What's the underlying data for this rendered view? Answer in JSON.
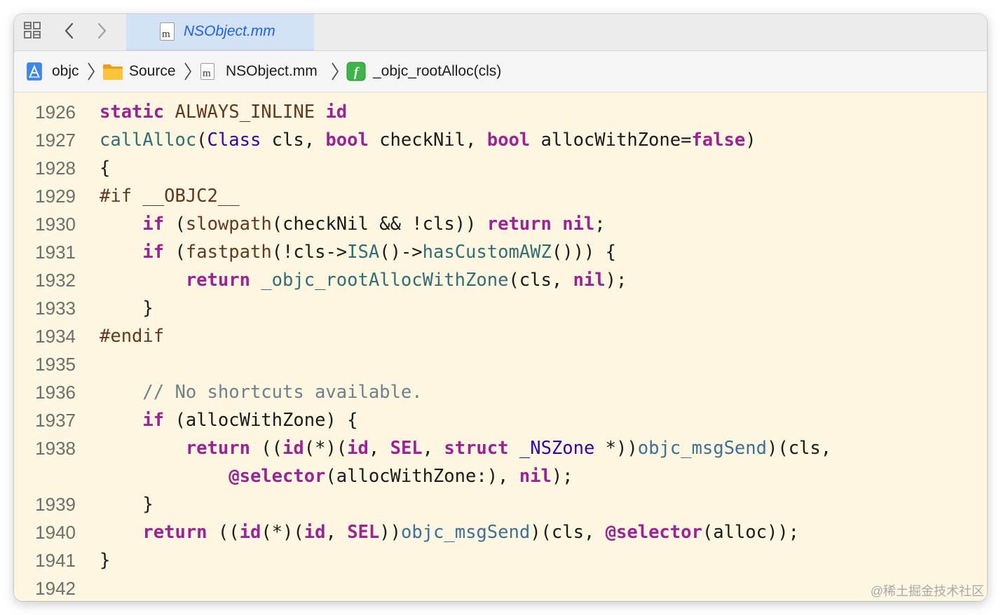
{
  "tab": {
    "label": "NSObject.mm"
  },
  "breadcrumb": {
    "items": [
      {
        "label": "objc",
        "icon": "project-icon"
      },
      {
        "label": "Source",
        "icon": "folder-icon"
      },
      {
        "label": "NSObject.mm",
        "icon": "objc-file-icon"
      },
      {
        "label": "_objc_rootAlloc(cls)",
        "icon": "function-icon"
      }
    ]
  },
  "editor": {
    "line_numbers": [
      "1926",
      "1927",
      "1928",
      "1929",
      "1930",
      "1931",
      "1932",
      "1933",
      "1934",
      "1935",
      "1936",
      "1937",
      "1938",
      "1939",
      "1940",
      "1941",
      "1942"
    ],
    "lines": [
      [
        [
          "kw",
          "static"
        ],
        [
          "p",
          " "
        ],
        [
          "mc",
          "ALWAYS_INLINE"
        ],
        [
          "p",
          " "
        ],
        [
          "kw",
          "id"
        ]
      ],
      [
        [
          "fn",
          "callAlloc"
        ],
        [
          "p",
          "("
        ],
        [
          "ty",
          "Class"
        ],
        [
          "p",
          " cls, "
        ],
        [
          "kw",
          "bool"
        ],
        [
          "p",
          " checkNil, "
        ],
        [
          "kw",
          "bool"
        ],
        [
          "p",
          " allocWithZone="
        ],
        [
          "kw",
          "false"
        ],
        [
          "p",
          ")"
        ]
      ],
      [
        [
          "p",
          "{"
        ]
      ],
      [
        [
          "pp",
          "#if __OBJC2__"
        ]
      ],
      [
        [
          "p",
          "    "
        ],
        [
          "kw",
          "if"
        ],
        [
          "p",
          " ("
        ],
        [
          "mc",
          "slowpath"
        ],
        [
          "p",
          "(checkNil && !cls)) "
        ],
        [
          "kw",
          "return"
        ],
        [
          "p",
          " "
        ],
        [
          "kw",
          "nil"
        ],
        [
          "p",
          ";"
        ]
      ],
      [
        [
          "p",
          "    "
        ],
        [
          "kw",
          "if"
        ],
        [
          "p",
          " ("
        ],
        [
          "mc",
          "fastpath"
        ],
        [
          "p",
          "(!cls->"
        ],
        [
          "fn",
          "ISA"
        ],
        [
          "p",
          "()->"
        ],
        [
          "fn",
          "hasCustomAWZ"
        ],
        [
          "p",
          "())) {"
        ]
      ],
      [
        [
          "p",
          "        "
        ],
        [
          "kw",
          "return"
        ],
        [
          "p",
          " "
        ],
        [
          "fn",
          "_objc_rootAllocWithZone"
        ],
        [
          "p",
          "(cls, "
        ],
        [
          "kw",
          "nil"
        ],
        [
          "p",
          ");"
        ]
      ],
      [
        [
          "p",
          "    }"
        ]
      ],
      [
        [
          "pp",
          "#endif"
        ]
      ],
      [
        [
          "p",
          ""
        ]
      ],
      [
        [
          "p",
          "    "
        ],
        [
          "cm",
          "// No shortcuts available."
        ]
      ],
      [
        [
          "p",
          "    "
        ],
        [
          "kw",
          "if"
        ],
        [
          "p",
          " (allocWithZone) {"
        ]
      ],
      [
        [
          "p",
          "        "
        ],
        [
          "kw",
          "return"
        ],
        [
          "p",
          " (("
        ],
        [
          "kw",
          "id"
        ],
        [
          "p",
          "(*)("
        ],
        [
          "kw",
          "id"
        ],
        [
          "p",
          ", "
        ],
        [
          "kw",
          "SEL"
        ],
        [
          "p",
          ", "
        ],
        [
          "kw",
          "struct"
        ],
        [
          "p",
          " "
        ],
        [
          "ty",
          "_NSZone"
        ],
        [
          "p",
          " *))"
        ],
        [
          "fn2",
          "objc_msgSend"
        ],
        [
          "p",
          ")(cls,"
        ]
      ],
      [
        [
          "p",
          "            "
        ],
        [
          "kw",
          "@selector"
        ],
        [
          "p",
          "(allocWithZone:), "
        ],
        [
          "kw",
          "nil"
        ],
        [
          "p",
          ");"
        ]
      ],
      [
        [
          "p",
          "    }"
        ]
      ],
      [
        [
          "p",
          "    "
        ],
        [
          "kw",
          "return"
        ],
        [
          "p",
          " (("
        ],
        [
          "kw",
          "id"
        ],
        [
          "p",
          "(*)("
        ],
        [
          "kw",
          "id"
        ],
        [
          "p",
          ", "
        ],
        [
          "kw",
          "SEL"
        ],
        [
          "p",
          "))"
        ],
        [
          "fn2",
          "objc_msgSend"
        ],
        [
          "p",
          ")(cls, "
        ],
        [
          "kw",
          "@selector"
        ],
        [
          "p",
          "(alloc));"
        ]
      ],
      [
        [
          "p",
          "}"
        ]
      ],
      [
        [
          "p",
          ""
        ]
      ]
    ]
  },
  "watermark": "@稀土掘金技术社区",
  "colors": {
    "keyword": "#9b2393",
    "function": "#326d74",
    "type": "#3900a0",
    "preprocessor": "#643820",
    "comment": "#707f8c",
    "editor_bg": "#fdf6e0",
    "tab_active_text": "#1e5ff0"
  }
}
